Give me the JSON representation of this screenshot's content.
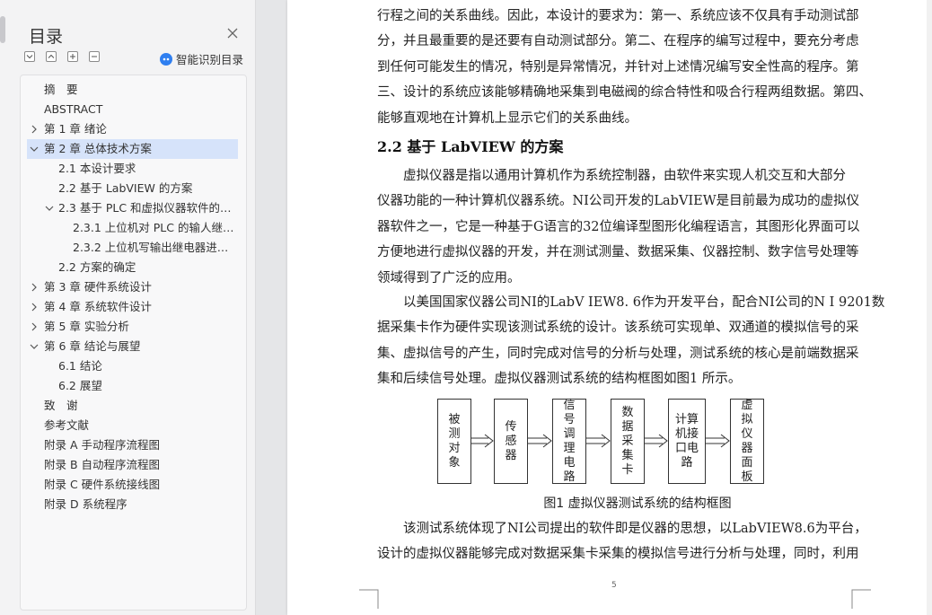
{
  "sidebar": {
    "title": "目录",
    "smart_toc_label": "智能识别目录",
    "items": [
      {
        "label": "摘　要"
      },
      {
        "label": "ABSTRACT"
      },
      {
        "label": "第 1 章  绪论"
      },
      {
        "label": "第 2 章  总体技术方案"
      },
      {
        "label": "2.1 本设计要求"
      },
      {
        "label": "2.2 基于 LabVIEW 的方案"
      },
      {
        "label": "2.3 基于 PLC 和虚拟仪器软件的方 ..."
      },
      {
        "label": "2.3.1 上位机对 PLC 的输人继电 ..."
      },
      {
        "label": "2.3.2 上位机写输出继电器进行 ..."
      },
      {
        "label": "2.2 方案的确定"
      },
      {
        "label": "第 3 章  硬件系统设计"
      },
      {
        "label": "第 4 章  系统软件设计"
      },
      {
        "label": "第 5 章  实验分析"
      },
      {
        "label": "第 6 章  结论与展望"
      },
      {
        "label": "6.1 结论"
      },
      {
        "label": "6.2 展望"
      },
      {
        "label": "致　谢"
      },
      {
        "label": "参考文献"
      },
      {
        "label": "附录 A  手动程序流程图"
      },
      {
        "label": "附录 B  自动程序流程图"
      },
      {
        "label": "附录 C  硬件系统接线图"
      },
      {
        "label": "附录 D  系统程序"
      }
    ],
    "selected_index": 3
  },
  "document": {
    "para1": [
      "行程之间的关系曲线。因此，本设计的要求为：第一、系统应该不仅具有手动测试部",
      "分，并且最重要的是还要有自动测试部分。第二、在程序的编写过程中，要充分考虑",
      "到任何可能发生的情况，特别是异常情况，并针对上述情况编写安全性高的程序。第",
      "三、设计的系统应该能够精确地采集到电磁阀的综合特性和吸合行程两组数据。第四、",
      "能够直观地在计算机上显示它们的关系曲线。"
    ],
    "heading": "2.2 基于 LabVIEW 的方案",
    "para2": [
      "　　虚拟仪器是指以通用计算机作为系统控制器，由软件来实现人机交互和大部分",
      "仪器功能的一种计算机仪器系统。NI公司开发的LabVIEW是目前最为成功的虚拟仪",
      "器软件之一，它是一种基于G语言的32位编译型图形化编程语言，其图形化界面可以",
      "方便地进行虚拟仪器的开发，并在测试测量、数据采集、仪器控制、数字信号处理等",
      "领域得到了广泛的应用。"
    ],
    "para3": [
      "　　以美国国家仪器公司NI的LabV IEW8. 6作为开发平台，配合NI公司的N I 9201数",
      "据采集卡作为硬件实现该测试系统的设计。该系统可实现单、双通道的模拟信号的采",
      "集、虚拟信号的产生，同时完成对信号的分析与处理，测试系统的核心是前端数据采",
      "集和后续信号处理。虚拟仪器测试系统的结构框图如图1  所示。"
    ],
    "diagram_boxes": [
      "被测对象",
      "传感器",
      "信号调理电路",
      "数据采集卡",
      "计算机接口电路",
      "虚拟仪器面板"
    ],
    "caption": "图1  虚拟仪器测试系统的结构框图",
    "para4": [
      "　　该测试系统体现了NI公司提出的软件即是仪器的思想，以LabVIEW8.6为平台，",
      "设计的虚拟仪器能够完成对数据采集卡采集的模拟信号进行分析与处理，同时，利用"
    ],
    "page_number": "5"
  },
  "colors": {
    "selection": "#d6e3fa",
    "accent": "#2f7ff0"
  }
}
